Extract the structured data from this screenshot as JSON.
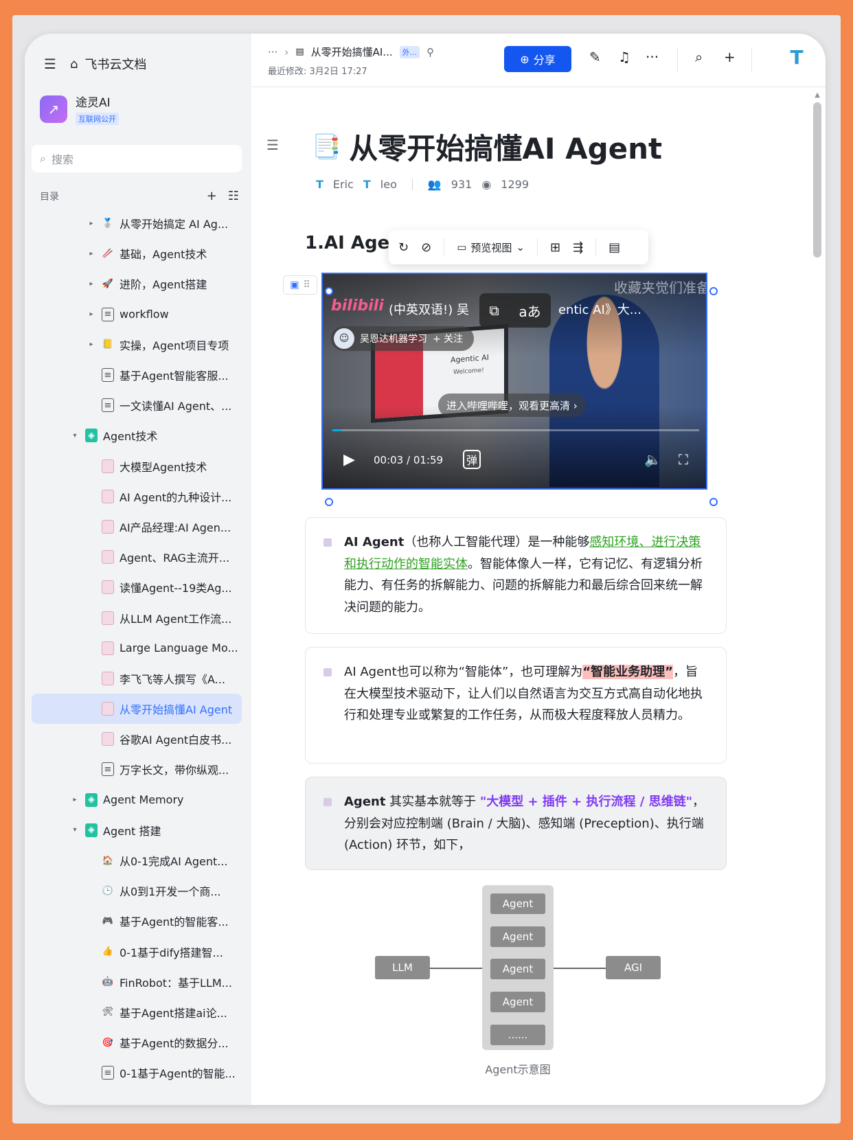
{
  "sidebar": {
    "app_name": "飞书云文档",
    "workspace": {
      "name": "途灵AI",
      "tag": "互联网公开"
    },
    "search_placeholder": "搜索",
    "toc_label": "目录",
    "items": [
      {
        "label": "从零开始搞定 AI Ag...",
        "icon": "🥈"
      },
      {
        "label": "基础，Agent技术",
        "icon": "🥢"
      },
      {
        "label": "进阶，Agent搭建",
        "icon": "🚀"
      },
      {
        "label": "workflow",
        "icon": "page"
      },
      {
        "label": "实操，Agent项目专项",
        "icon": "📒"
      },
      {
        "label": "基于Agent智能客服...",
        "icon": "page"
      },
      {
        "label": "一文读懂AI Agent、...",
        "icon": "page"
      },
      {
        "label": "Agent技术",
        "icon": "tag"
      },
      {
        "label": "大模型Agent技术",
        "icon": "doc"
      },
      {
        "label": "AI Agent的九种设计...",
        "icon": "doc"
      },
      {
        "label": "AI产品经理:AI Agen...",
        "icon": "doc"
      },
      {
        "label": "Agent、RAG主流开...",
        "icon": "doc"
      },
      {
        "label": "读懂Agent--19类Ag...",
        "icon": "doc"
      },
      {
        "label": "从LLM Agent工作流...",
        "icon": "doc"
      },
      {
        "label": "Large Language Mo...",
        "icon": "doc"
      },
      {
        "label": "李飞飞等人撰写《A...",
        "icon": "doc"
      },
      {
        "label": "从零开始搞懂AI Agent",
        "icon": "doc"
      },
      {
        "label": "谷歌AI Agent白皮书...",
        "icon": "doc"
      },
      {
        "label": "万字长文，带你纵观...",
        "icon": "page"
      },
      {
        "label": "Agent Memory",
        "icon": "tag"
      },
      {
        "label": "Agent 搭建",
        "icon": "tag"
      },
      {
        "label": "从0-1完成AI Agent...",
        "icon": "🏠"
      },
      {
        "label": "从0到1开发一个商...",
        "icon": "🕒"
      },
      {
        "label": "基于Agent的智能客...",
        "icon": "🎮"
      },
      {
        "label": "0-1基于dify搭建智...",
        "icon": "👍"
      },
      {
        "label": "FinRobot：基于LLM...",
        "icon": "🤖"
      },
      {
        "label": "基于Agent搭建ai论...",
        "icon": "🛠"
      },
      {
        "label": "基于Agent的数据分...",
        "icon": "🎯"
      },
      {
        "label": "0-1基于Agent的智能...",
        "icon": "page"
      }
    ]
  },
  "topbar": {
    "crumb_dots": "···",
    "crumb_title": "从零开始搞懂AI...",
    "crumb_badge": "外...",
    "modified": "最近修改: 3月2日 17:27",
    "share_label": "分享"
  },
  "doc": {
    "title": "从零开始搞懂AI Agent",
    "authors": [
      "Eric",
      "leo"
    ],
    "likes": "931",
    "views": "1299",
    "h2": "1.AI Agen",
    "view_toolbar_label": "预览视图"
  },
  "video": {
    "brand": "bilibili",
    "title": "(中英双语!) 吴恩达《Agentic AI》大...",
    "title_left": "(中英双语!) 吴",
    "title_right": "entic AI》大...",
    "watermark": "收藏夹觉们准备",
    "uploader": "吴恩达机器学习",
    "follow": "+ 关注",
    "cta": "进入哔哩哔哩，观看更高清 ›",
    "time_current": "00:03",
    "time_total": "01:59",
    "progress": 0.025,
    "danmaku": "弹",
    "screen_title": "Agentic AI",
    "screen_sub": "Welcome!"
  },
  "callouts": [
    {
      "bold": "AI Agent",
      "t1": "（也称人工智能代理）是一种能够",
      "link": "感知环境、进行决策和执行动作的智能实体",
      "t2": "。智能体像人一样，它有记忆、有逻辑分析能力、有任务的拆解能力、问题的拆解能力和最后综合回来统一解决问题的能力。"
    },
    {
      "t1": "AI Agent也可以称为“智能体”，也可理解为",
      "highlight": "“智能业务助理”",
      "t2": "，旨在大模型技术驱动下，让人们以自然语言为交互方式高自动化地执行和处理专业或繁复的工作任务，从而极大程度释放人员精力。"
    },
    {
      "bold": "Agent",
      "t1": " 其实基本就等于 ",
      "purple": "\"大模型 + 插件 + 执行流程 / 思维链\"",
      "t2": "，分别会对应控制端 (Brain / 大脑)、感知端 (Preception)、执行端 (Action) 环节，如下，"
    }
  ],
  "diagram": {
    "left": "LLM",
    "agents": [
      "Agent",
      "Agent",
      "Agent",
      "Agent",
      "......"
    ],
    "right": "AGI",
    "caption": "Agent示意图"
  }
}
